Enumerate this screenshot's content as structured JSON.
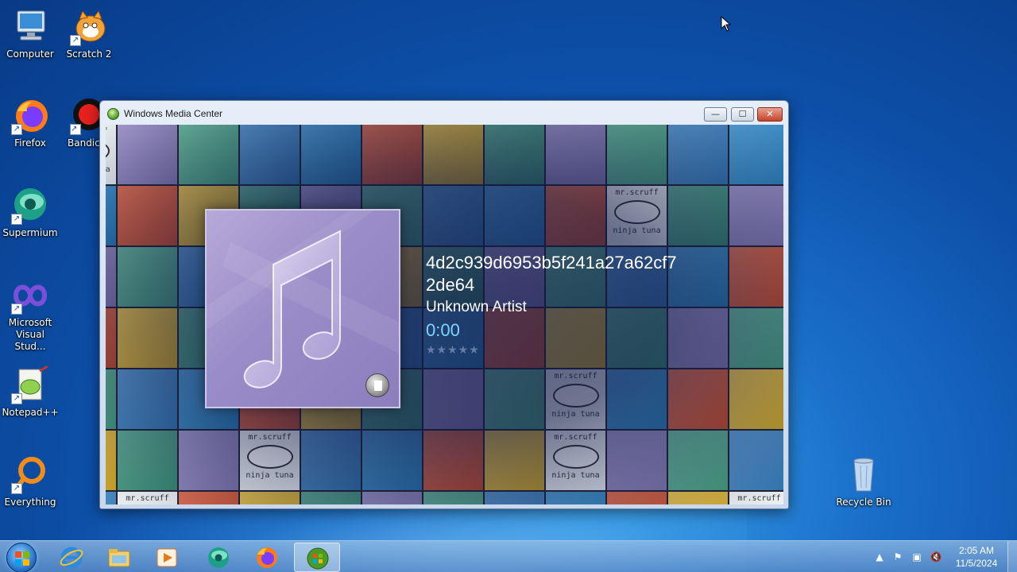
{
  "desktop": {
    "icons": [
      {
        "label": "Computer",
        "icon": "computer-icon"
      },
      {
        "label": "Scratch 2",
        "icon": "scratch-icon"
      },
      {
        "label": "Firefox",
        "icon": "firefox-icon"
      },
      {
        "label": "Bandica",
        "icon": "bandicam-icon"
      },
      {
        "label": "Supermium",
        "icon": "supermium-icon"
      },
      {
        "label": "Microsoft Visual Stud...",
        "icon": "visual-studio-icon"
      },
      {
        "label": "Notepad++",
        "icon": "notepadpp-icon"
      },
      {
        "label": "Everything",
        "icon": "everything-icon"
      },
      {
        "label": "Recycle Bin",
        "icon": "recycle-bin-icon"
      }
    ]
  },
  "window": {
    "title": "Windows Media Center",
    "controls": {
      "minimize": "—",
      "maximize": "☐",
      "close": "✕"
    }
  },
  "tile_text": {
    "line1": "mr.scruff",
    "line2": "ninja tuna"
  },
  "now_playing": {
    "title": "4d2c939d6953b5f241a27a62cf72de64",
    "artist": "Unknown Artist",
    "time": "0:00",
    "rating_stars": "★★★★★",
    "rating": 0
  },
  "taskbar": {
    "apps": [
      "internet-explorer-icon",
      "file-explorer-icon",
      "media-player-icon",
      "supermium-icon",
      "firefox-icon",
      "media-center-icon"
    ],
    "active_app": "media-center-icon",
    "clock_time": "2:05 AM",
    "clock_date": "11/5/2024"
  },
  "colors": {
    "accent_time": "#7fd3ff",
    "tile_palette": [
      "#3f9b7e",
      "#e0552e",
      "#3a86c8",
      "#9487c5",
      "#e6b92a",
      "#2f8fd0",
      "#4fb08c"
    ]
  }
}
